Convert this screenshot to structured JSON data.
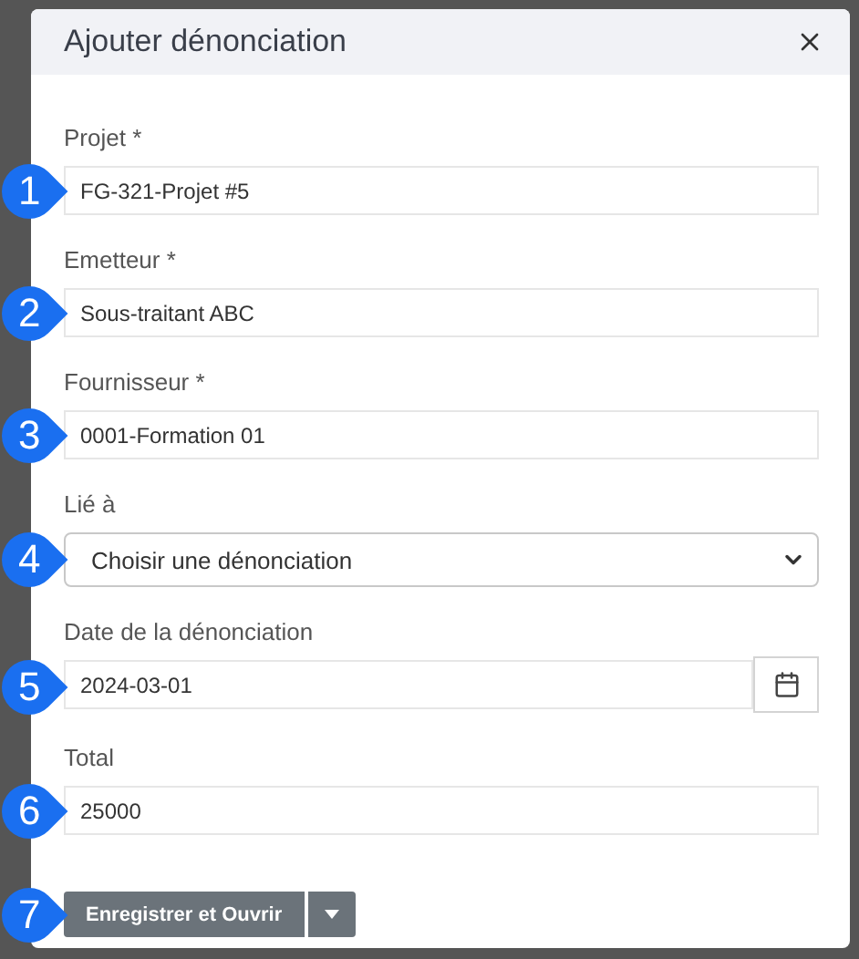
{
  "dialog": {
    "title": "Ajouter dénonciation"
  },
  "fields": [
    {
      "kind": "text",
      "label": "Projet *",
      "value": "FG-321-Projet #5",
      "marker": "1"
    },
    {
      "kind": "text",
      "label": "Emetteur *",
      "value": "Sous-traitant ABC",
      "marker": "2"
    },
    {
      "kind": "text",
      "label": "Fournisseur *",
      "value": "0001-Formation 01",
      "marker": "3"
    },
    {
      "kind": "select",
      "label": "Lié à",
      "value": "Choisir une dénonciation",
      "marker": "4"
    },
    {
      "kind": "date",
      "label": "Date de la dénonciation",
      "value": "2024-03-01",
      "marker": "5"
    },
    {
      "kind": "text",
      "label": "Total",
      "value": "25000",
      "marker": "6"
    }
  ],
  "action": {
    "label": "Enregistrer et Ouvrir",
    "marker": "7"
  }
}
